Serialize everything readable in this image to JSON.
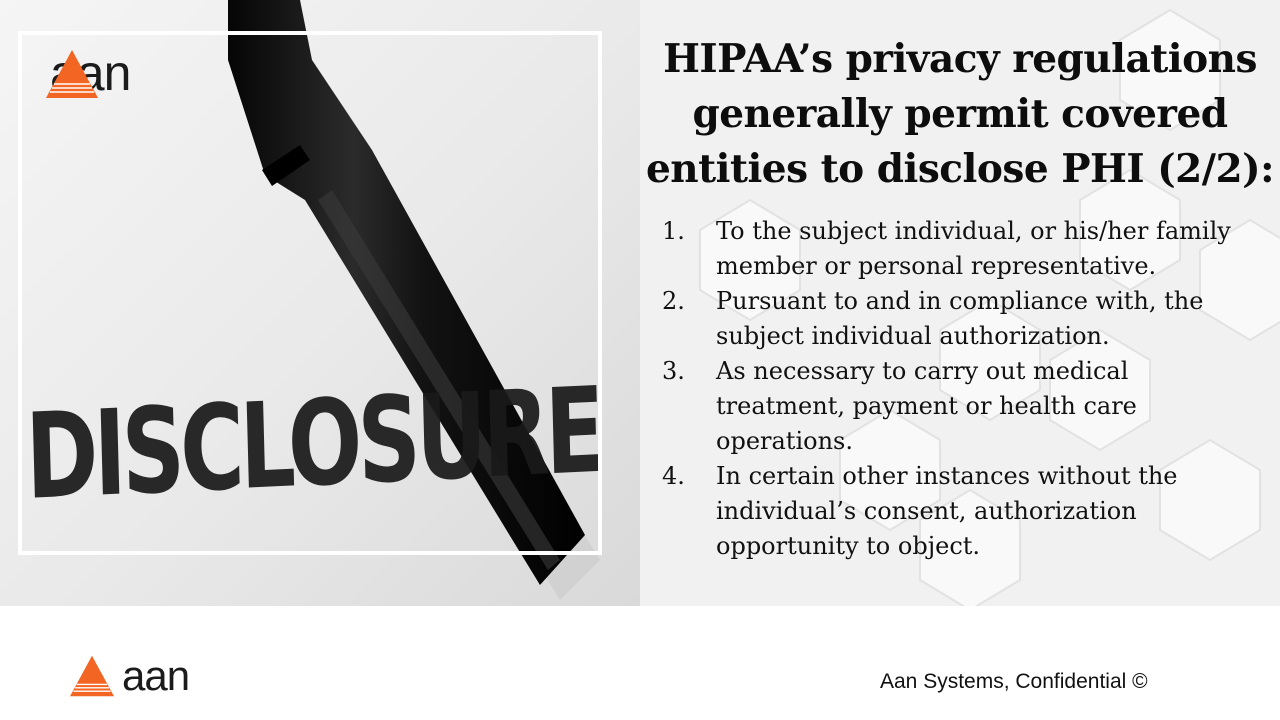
{
  "logo": {
    "text": "aan",
    "icon": "orange-triangle-logo-icon",
    "accent_color": "#f26522"
  },
  "image": {
    "word": "DISCLOSURE"
  },
  "slide": {
    "title": "HIPAA’s privacy regulations generally permit covered entities to disclose PHI (2/2):",
    "points": [
      {
        "number": "1.",
        "text": "To the subject individual, or his/her family member or personal representative."
      },
      {
        "number": "2.",
        "text": "Pursuant to and in compliance with, the subject individual authorization."
      },
      {
        "number": "3.",
        "text": "As necessary to carry out medical treatment, payment or health care operations."
      },
      {
        "number": "4.",
        "text": "In certain other instances without the individual’s consent, authorization opportunity to object."
      }
    ]
  },
  "footer": {
    "confidential": "Aan Systems, Confidential ©"
  }
}
